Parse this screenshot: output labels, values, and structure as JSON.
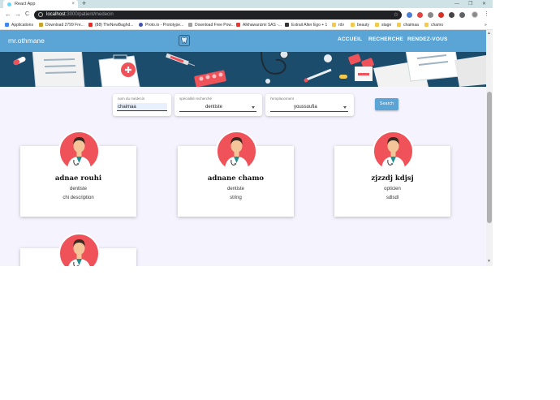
{
  "browser": {
    "tab_title": "React App",
    "tab_close": "×",
    "new_tab": "+",
    "window_controls": [
      "—",
      "❐",
      "✕"
    ],
    "url_host": "localhost",
    "url_path": ":3000/patient/medecin",
    "back": "←",
    "forward": "→",
    "reload": "C",
    "star": "☆",
    "menu": "⋮",
    "bookmarks": [
      {
        "label": "Applications",
        "icon_color": "#4285f4"
      },
      {
        "label": "Download 2799 Fre...",
        "icon_color": "#c9a227"
      },
      {
        "label": "(88) TheNewBaghd...",
        "icon_color": "#e52d27"
      },
      {
        "label": "Proto.io - Prototype...",
        "icon_color": "#3f51b5"
      },
      {
        "label": "Download Free Pow...",
        "icon_color": "#9e9e9e"
      },
      {
        "label": "Alkhawarizmi SAS -...",
        "icon_color": "#e53935"
      },
      {
        "label": "Extrait Alter Ego + 1",
        "icon_color": "#333333"
      },
      {
        "label": "rdv",
        "icon_color": "#f2c94c"
      },
      {
        "label": "beauty",
        "icon_color": "#f2c94c"
      },
      {
        "label": "stage",
        "icon_color": "#f2c94c"
      },
      {
        "label": "chaimaa",
        "icon_color": "#f2c94c"
      },
      {
        "label": "chamo",
        "icon_color": "#f2c94c"
      }
    ],
    "bookmarks_overflow": "»"
  },
  "header": {
    "brand": "mr.othmane",
    "nav": [
      "ACCUEIL",
      "RECHERCHE",
      "RENDEZ-VOUS"
    ],
    "color": "#5aa4d6"
  },
  "search": {
    "name_label": "nom du médecin",
    "name_value": "chaimaa",
    "speciality_label": "spécialité recherché",
    "speciality_value": "dentiste",
    "location_label": "l'emplacement",
    "location_value": "youssoufia",
    "button": "Search"
  },
  "doctors": [
    {
      "name": "adnae rouhi",
      "speciality": "dentiste",
      "description": "chi description"
    },
    {
      "name": "adnane chamo",
      "speciality": "dentiste",
      "description": "string"
    },
    {
      "name": "zjzzdj kdjsj",
      "speciality": "opticien",
      "description": "sdlsdl"
    },
    {
      "name": "",
      "speciality": "",
      "description": ""
    }
  ],
  "colors": {
    "accent": "#5aa4d6",
    "banner": "#1b4c6c",
    "avatar_bg": "#f0525a",
    "page_bg": "#f5f3fd"
  }
}
